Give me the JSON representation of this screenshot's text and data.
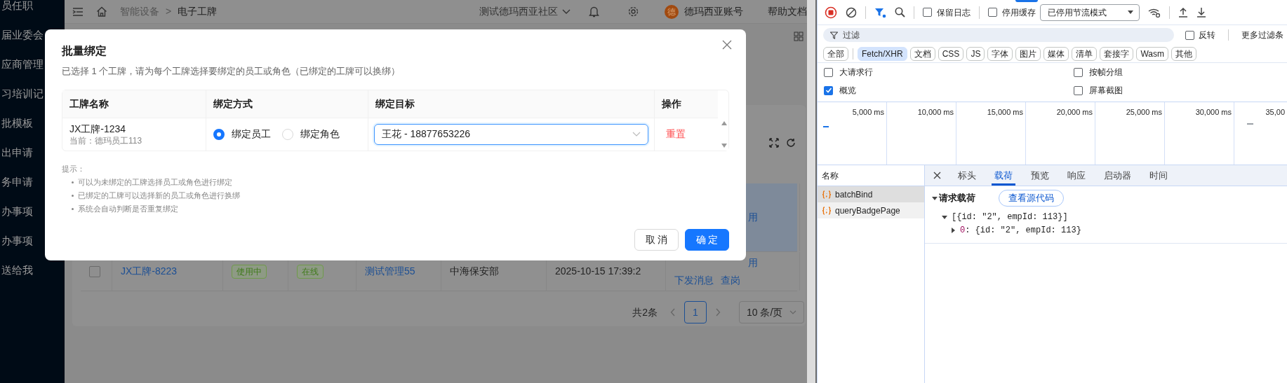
{
  "sidebar": {
    "items": [
      "员任职",
      "届业委会",
      "应商管理",
      "习培训记",
      "批模板",
      "出申请",
      "务申请",
      "办事项",
      "办事项",
      "送给我"
    ]
  },
  "header": {
    "breadcrumb": [
      "智能设备",
      "电子工牌"
    ],
    "breadcrumb_separator": ">",
    "community": "测试德玛西亚社区",
    "avatar": "德",
    "account": "德玛西亚账号",
    "help": "帮助文档"
  },
  "table": {
    "rows": [
      {
        "selected": true,
        "action_lines": [
          [
            "用"
          ]
        ]
      },
      {
        "selected": false,
        "checked": false,
        "name": "JX工牌-8223",
        "usage": "使用中",
        "status": "在线",
        "manager": "测试管理55",
        "department": "中海保安部",
        "time": "2025-10-15 17:39:2",
        "action_lines": [
          [
            "用"
          ],
          [
            "下发消息",
            "查岗"
          ]
        ]
      }
    ]
  },
  "pagination": {
    "total": "共2条",
    "pages": [
      {
        "label": "1",
        "selected": true
      }
    ],
    "page_size": "10 条/页"
  },
  "dialog": {
    "title": "批量绑定",
    "subtitle": "已选择 1 个工牌，请为每个工牌选择要绑定的员工或角色（已绑定的工牌可以换绑）",
    "columns": [
      "工牌名称",
      "绑定方式",
      "绑定目标",
      "操作"
    ],
    "rows": [
      {
        "name": "JX工牌-1234",
        "current": "当前：德玛员工113",
        "modes": [
          {
            "label": "绑定员工",
            "selected": true
          },
          {
            "label": "绑定角色",
            "selected": false
          }
        ],
        "target": "王花 - 18877653226",
        "action": "重置"
      }
    ],
    "tips_title": "提示：",
    "tips": [
      "可以为未绑定的工牌选择员工或角色进行绑定",
      "已绑定的工牌可以选择新的员工或角色进行换绑",
      "系统会自动判断是否重复绑定"
    ],
    "buttons": [
      {
        "label": "取 消",
        "kind": "default"
      },
      {
        "label": "确 定",
        "kind": "primary"
      }
    ]
  },
  "devtools": {
    "toolbar": {
      "preserve_log": {
        "label": "保留日志",
        "checked": false
      },
      "disable_cache": {
        "label": "停用缓存",
        "checked": false
      },
      "throttling": "已停用节流模式"
    },
    "filter": {
      "placeholder": "过滤",
      "invert": {
        "label": "反转",
        "checked": false
      },
      "more_filters": "更多过滤条"
    },
    "type_filters": [
      {
        "label": "全部",
        "selected": false
      },
      {
        "label": "Fetch/XHR",
        "selected": true
      },
      {
        "label": "文档",
        "selected": false
      },
      {
        "label": "CSS",
        "selected": false
      },
      {
        "label": "JS",
        "selected": false
      },
      {
        "label": "字体",
        "selected": false
      },
      {
        "label": "图片",
        "selected": false
      },
      {
        "label": "媒体",
        "selected": false
      },
      {
        "label": "清单",
        "selected": false
      },
      {
        "label": "套接字",
        "selected": false
      },
      {
        "label": "Wasm",
        "selected": false
      },
      {
        "label": "其他",
        "selected": false
      }
    ],
    "options": [
      {
        "label": "大请求行",
        "checked": false
      },
      {
        "label": "按帧分组",
        "checked": false
      },
      {
        "label": "概览",
        "checked": true
      },
      {
        "label": "屏幕截图",
        "checked": false
      }
    ],
    "timeline_ticks": [
      "5,000 ms",
      "10,000 ms",
      "15,000 ms",
      "20,000 ms",
      "25,000 ms",
      "30,000 ms",
      "35,00"
    ],
    "requests": {
      "header": "名称",
      "items": [
        {
          "name": "batchBind",
          "selected": true
        },
        {
          "name": "queryBadgePage",
          "selected": false
        }
      ]
    },
    "detail_tabs": [
      {
        "label": "标头",
        "selected": false
      },
      {
        "label": "载荷",
        "selected": true
      },
      {
        "label": "预览",
        "selected": false
      },
      {
        "label": "响应",
        "selected": false
      },
      {
        "label": "启动器",
        "selected": false
      },
      {
        "label": "时间",
        "selected": false
      }
    ],
    "payload": {
      "title": "请求载荷",
      "expanded": true,
      "view_source": "查看源代码",
      "tree": [
        {
          "text": "[{id: \"2\", empId: 113}]",
          "expanded": true,
          "children": [
            {
              "key": "0",
              "text": ": {id: \"2\", empId: 113}",
              "expanded": false
            }
          ]
        }
      ]
    }
  }
}
